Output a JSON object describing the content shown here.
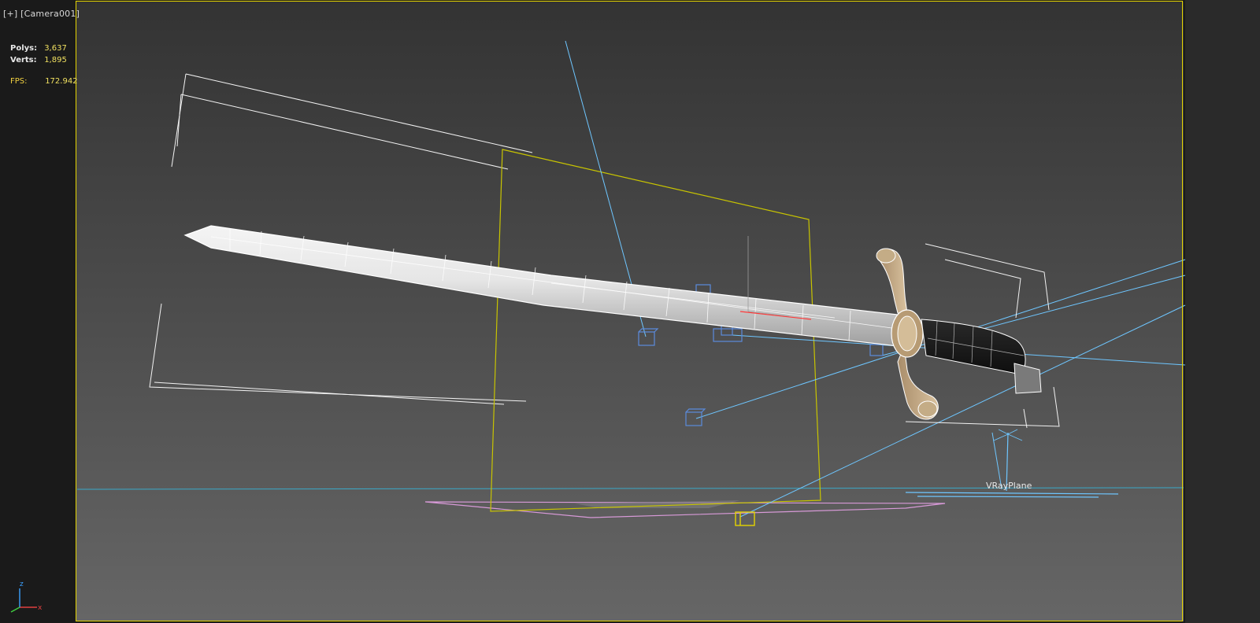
{
  "viewport": {
    "menu_label": "[+]",
    "view_label": "[Camera001]",
    "border_color": "#e4d400"
  },
  "stats": {
    "polys_label": "Polys:",
    "polys_value": "3,637",
    "verts_label": "Verts:",
    "verts_value": "1,895",
    "fps_label": "FPS:",
    "fps_value": "172.942"
  },
  "scene": {
    "plane_label": "VRayPlane",
    "light_color": "#6ec6ff",
    "camera_target_color": "#d7d200",
    "ground_color": "#d89ad8"
  },
  "axis_gizmo": {
    "x_label": "x",
    "z_label": "z"
  }
}
